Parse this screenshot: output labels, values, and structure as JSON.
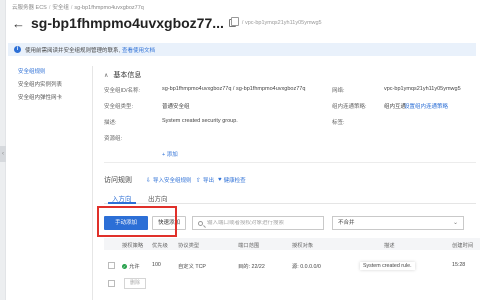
{
  "breadcrumb": [
    "云服务器 ECS",
    "安全组",
    "sg-bp1fhmpmo4uvxgboz77q"
  ],
  "title": "sg-bp1fhmpmo4uvxgboz77...",
  "vpc_id": "/ vpc-bp1ymqs21yh11y05ymwg5",
  "banner": {
    "text": "使用前需阅读并安全组规则管理的联系,",
    "link": "查看使用文档"
  },
  "side_nav": [
    "安全组规则",
    "安全组内实例列表",
    "安全组内弹性网卡"
  ],
  "basic_info": {
    "heading": "基本信息",
    "fields": {
      "sg_id": {
        "label": "安全组ID/名称:",
        "value": "sg-bp1fhmpmo4uvxgboz77q / sg-bp1fhmpmo4uvxgboz77q"
      },
      "network": {
        "label": "网络:",
        "value": "vpc-bp1ymqs21yh11y05ymwg5"
      },
      "sg_type": {
        "label": "安全组类型:",
        "value": "普通安全组"
      },
      "intra_policy": {
        "label": "组内连通策略:",
        "value": "组内互通",
        "link": "设置组内连通策略"
      },
      "description": {
        "label": "描述:",
        "value": "System created security group."
      },
      "tags": {
        "label": "标签:",
        "value": ""
      },
      "resource_group": {
        "label": "资源组:",
        "value": ""
      },
      "add": "+ 添加"
    }
  },
  "rules": {
    "heading": "访问规则",
    "toolbar": {
      "import": "导入安全组规则",
      "export": "导出",
      "health": "健康检查"
    },
    "tabs": [
      "入方向",
      "出方向"
    ],
    "manual_add": "手动添加",
    "quick_add": "快速添加",
    "search_placeholder": "输入端口或者授权对象进行搜索",
    "select_value": "不合并",
    "columns": [
      "授权策略",
      "优先级",
      "协议类型",
      "端口范围",
      "授权对象",
      "描述",
      "创建时间"
    ],
    "row": {
      "policy": "允许",
      "priority": "100",
      "protocol": "自定义 TCP",
      "port": "目的: 22/22",
      "auth": "源: 0.0.0.0/0",
      "description": "System created rule.",
      "created": "15:28"
    },
    "delete": "删除"
  }
}
